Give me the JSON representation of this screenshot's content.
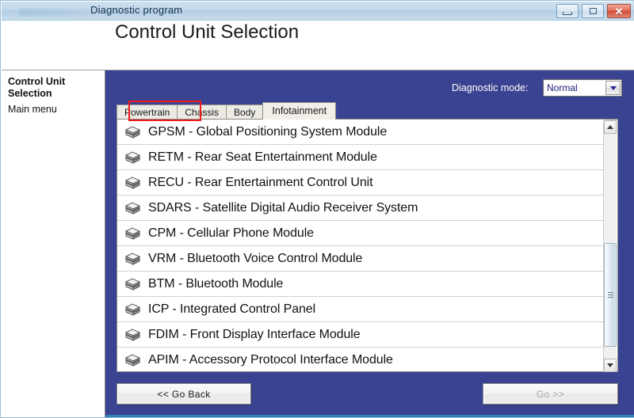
{
  "window": {
    "title": "Diagnostic program",
    "controls": {
      "minimize": "minimize-button",
      "maximize": "maximize-button",
      "close": "✕"
    }
  },
  "header": {
    "page_title": "Control Unit Selection"
  },
  "sidebar": {
    "title": "Control Unit Selection",
    "items": [
      {
        "label": "Main menu"
      }
    ]
  },
  "diagnostic_mode": {
    "label": "Diagnostic mode:",
    "value": "Normal",
    "options": [
      "Normal"
    ]
  },
  "tabs": [
    {
      "label": "Powertrain",
      "active": false
    },
    {
      "label": "Chassis",
      "active": false
    },
    {
      "label": "Body",
      "active": false
    },
    {
      "label": "Infotainment",
      "active": true
    }
  ],
  "highlight": {
    "target": "Infotainment",
    "color": "#ee1c1c"
  },
  "list": {
    "rows": [
      {
        "code": "GPSM",
        "label": "GPSM - Global Positioning System Module"
      },
      {
        "code": "RETM",
        "label": "RETM - Rear Seat Entertainment Module"
      },
      {
        "code": "RECU",
        "label": "RECU - Rear Entertainment Control Unit"
      },
      {
        "code": "SDARS",
        "label": "SDARS - Satellite Digital Audio Receiver System"
      },
      {
        "code": "CPM",
        "label": "CPM - Cellular Phone Module"
      },
      {
        "code": "VRM",
        "label": "VRM - Bluetooth Voice Control Module"
      },
      {
        "code": "BTM",
        "label": "BTM - Bluetooth Module"
      },
      {
        "code": "ICP",
        "label": "ICP - Integrated Control Panel"
      },
      {
        "code": "FDIM",
        "label": "FDIM - Front Display Interface Module"
      },
      {
        "code": "APIM",
        "label": "APIM - Accessory Protocol Interface Module"
      }
    ],
    "row_icon": "module-stack-icon"
  },
  "scrollbar": {
    "up_arrow": "scroll-up-icon",
    "down_arrow": "scroll-down-icon"
  },
  "buttons": {
    "back": "<< Go Back",
    "go": "Go >>",
    "go_disabled": true
  },
  "colors": {
    "content_blue": "#3a4391",
    "accent_rule": "#2f82b5",
    "highlight_red": "#ee1c1c",
    "select_text": "#1a1a7a"
  }
}
